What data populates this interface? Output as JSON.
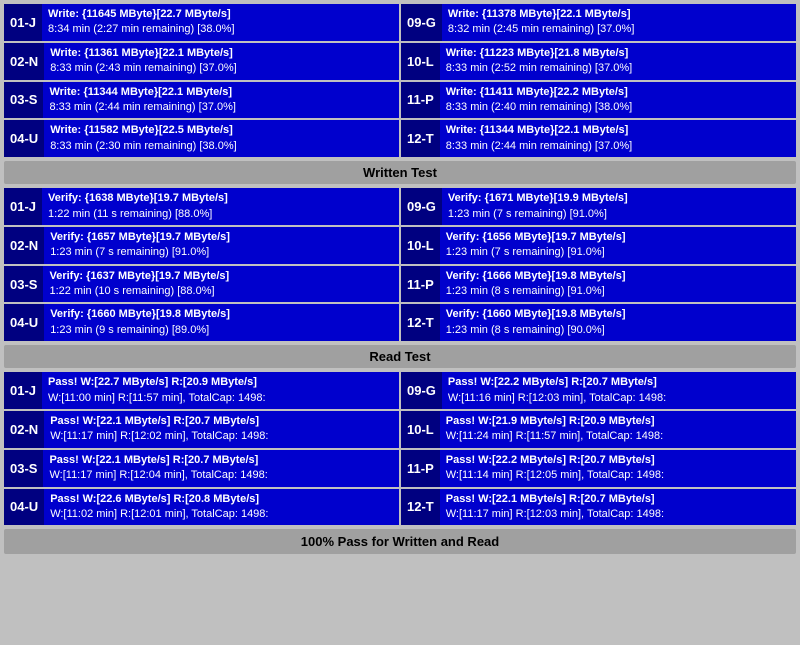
{
  "write_section": {
    "header": "Written Test",
    "left": [
      {
        "label": "01-J",
        "line1": "Write: {11645 MByte}[22.7 MByte/s]",
        "line2": "8:34 min (2:27 min remaining)  [38.0%]"
      },
      {
        "label": "02-N",
        "line1": "Write: {11361 MByte}[22.1 MByte/s]",
        "line2": "8:33 min (2:43 min remaining)  [37.0%]"
      },
      {
        "label": "03-S",
        "line1": "Write: {11344 MByte}[22.1 MByte/s]",
        "line2": "8:33 min (2:44 min remaining)  [37.0%]"
      },
      {
        "label": "04-U",
        "line1": "Write: {11582 MByte}[22.5 MByte/s]",
        "line2": "8:33 min (2:30 min remaining)  [38.0%]"
      }
    ],
    "right": [
      {
        "label": "09-G",
        "line1": "Write: {11378 MByte}[22.1 MByte/s]",
        "line2": "8:32 min (2:45 min remaining)  [37.0%]"
      },
      {
        "label": "10-L",
        "line1": "Write: {11223 MByte}[21.8 MByte/s]",
        "line2": "8:33 min (2:52 min remaining)  [37.0%]"
      },
      {
        "label": "11-P",
        "line1": "Write: {11411 MByte}[22.2 MByte/s]",
        "line2": "8:33 min (2:40 min remaining)  [38.0%]"
      },
      {
        "label": "12-T",
        "line1": "Write: {11344 MByte}[22.1 MByte/s]",
        "line2": "8:33 min (2:44 min remaining)  [37.0%]"
      }
    ]
  },
  "verify_section": {
    "header": "Written Test",
    "left": [
      {
        "label": "01-J",
        "line1": "Verify: {1638 MByte}[19.7 MByte/s]",
        "line2": "1:22 min (11 s remaining)   [88.0%]"
      },
      {
        "label": "02-N",
        "line1": "Verify: {1657 MByte}[19.7 MByte/s]",
        "line2": "1:23 min (7 s remaining)   [91.0%]"
      },
      {
        "label": "03-S",
        "line1": "Verify: {1637 MByte}[19.7 MByte/s]",
        "line2": "1:22 min (10 s remaining)   [88.0%]"
      },
      {
        "label": "04-U",
        "line1": "Verify: {1660 MByte}[19.8 MByte/s]",
        "line2": "1:23 min (9 s remaining)   [89.0%]"
      }
    ],
    "right": [
      {
        "label": "09-G",
        "line1": "Verify: {1671 MByte}[19.9 MByte/s]",
        "line2": "1:23 min (7 s remaining)   [91.0%]"
      },
      {
        "label": "10-L",
        "line1": "Verify: {1656 MByte}[19.7 MByte/s]",
        "line2": "1:23 min (7 s remaining)   [91.0%]"
      },
      {
        "label": "11-P",
        "line1": "Verify: {1666 MByte}[19.8 MByte/s]",
        "line2": "1:23 min (8 s remaining)   [91.0%]"
      },
      {
        "label": "12-T",
        "line1": "Verify: {1660 MByte}[19.8 MByte/s]",
        "line2": "1:23 min (8 s remaining)   [90.0%]"
      }
    ]
  },
  "read_section": {
    "header": "Read Test",
    "left": [
      {
        "label": "01-J",
        "line1": "Pass! W:[22.7 MByte/s] R:[20.9 MByte/s]",
        "line2": "W:[11:00 min] R:[11:57 min], TotalCap: 1498:"
      },
      {
        "label": "02-N",
        "line1": "Pass! W:[22.1 MByte/s] R:[20.7 MByte/s]",
        "line2": "W:[11:17 min] R:[12:02 min], TotalCap: 1498:"
      },
      {
        "label": "03-S",
        "line1": "Pass! W:[22.1 MByte/s] R:[20.7 MByte/s]",
        "line2": "W:[11:17 min] R:[12:04 min], TotalCap: 1498:"
      },
      {
        "label": "04-U",
        "line1": "Pass! W:[22.6 MByte/s] R:[20.8 MByte/s]",
        "line2": "W:[11:02 min] R:[12:01 min], TotalCap: 1498:"
      }
    ],
    "right": [
      {
        "label": "09-G",
        "line1": "Pass! W:[22.2 MByte/s] R:[20.7 MByte/s]",
        "line2": "W:[11:16 min] R:[12:03 min], TotalCap: 1498:"
      },
      {
        "label": "10-L",
        "line1": "Pass! W:[21.9 MByte/s] R:[20.9 MByte/s]",
        "line2": "W:[11:24 min] R:[11:57 min], TotalCap: 1498:"
      },
      {
        "label": "11-P",
        "line1": "Pass! W:[22.2 MByte/s] R:[20.7 MByte/s]",
        "line2": "W:[11:14 min] R:[12:05 min], TotalCap: 1498:"
      },
      {
        "label": "12-T",
        "line1": "Pass! W:[22.1 MByte/s] R:[20.7 MByte/s]",
        "line2": "W:[11:17 min] R:[12:03 min], TotalCap: 1498:"
      }
    ]
  },
  "status_bar": "100% Pass for Written and Read"
}
